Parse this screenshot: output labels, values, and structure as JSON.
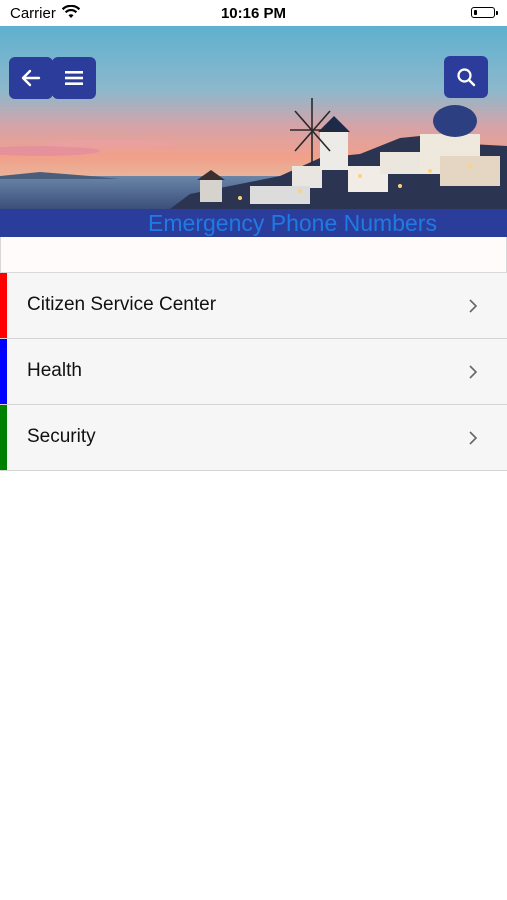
{
  "status_bar": {
    "carrier": "Carrier",
    "time": "10:16 PM"
  },
  "header": {
    "title": "Emergency Phone Numbers",
    "buttons": {
      "back_icon": "arrow-left-icon",
      "menu_icon": "hamburger-menu-icon",
      "search_icon": "search-icon"
    }
  },
  "categories": [
    {
      "label": "Citizen Service Center",
      "color": "#ff0000"
    },
    {
      "label": "Health",
      "color": "#0000ff"
    },
    {
      "label": "Security",
      "color": "#008000"
    }
  ],
  "colors": {
    "header_button": "#2c3c9a",
    "title_bar": "#2b3d9b",
    "title_text": "#1f7ae6",
    "list_background": "#f6f6f6"
  }
}
